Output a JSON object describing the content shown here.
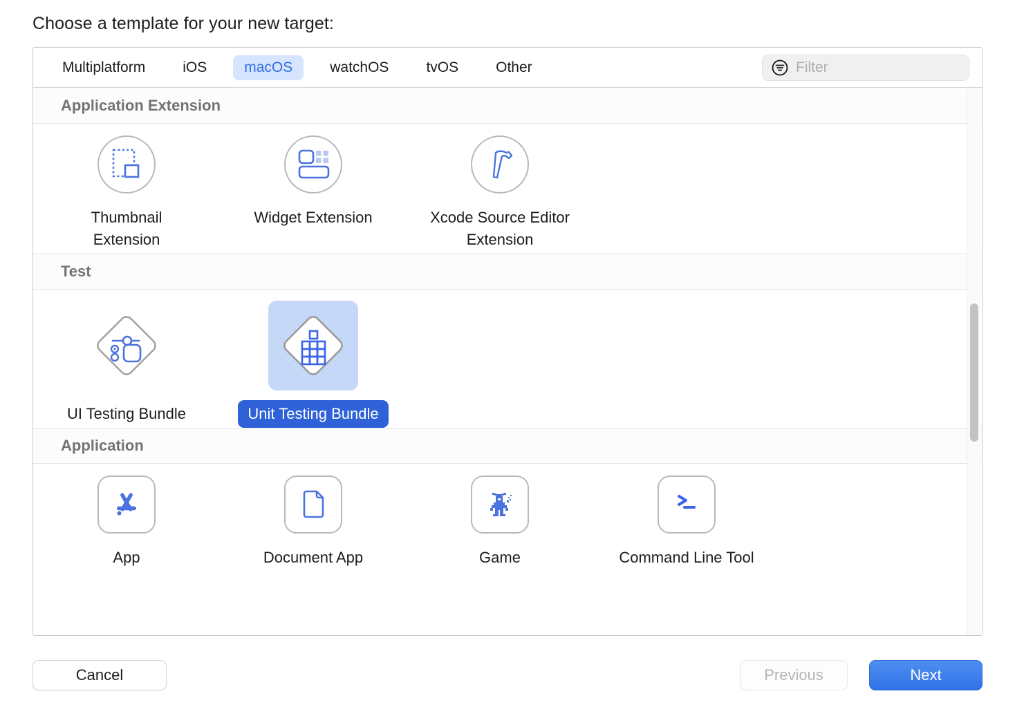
{
  "prompt": "Choose a template for your new target:",
  "tabs": [
    {
      "label": "Multiplatform",
      "active": false
    },
    {
      "label": "iOS",
      "active": false
    },
    {
      "label": "macOS",
      "active": true
    },
    {
      "label": "watchOS",
      "active": false
    },
    {
      "label": "tvOS",
      "active": false
    },
    {
      "label": "Other",
      "active": false
    }
  ],
  "filter": {
    "placeholder": "Filter",
    "icon": "filter-icon",
    "value": ""
  },
  "sections": [
    {
      "header": "Application Extension",
      "items": [
        {
          "label": "Thumbnail Extension",
          "icon": "thumbnail-extension-icon",
          "selected": false
        },
        {
          "label": "Widget Extension",
          "icon": "widget-extension-icon",
          "selected": false
        },
        {
          "label": "Xcode Source Editor Extension",
          "icon": "hammer-icon",
          "selected": false
        }
      ]
    },
    {
      "header": "Test",
      "items": [
        {
          "label": "UI Testing Bundle",
          "icon": "ui-testing-bundle-icon",
          "selected": false
        },
        {
          "label": "Unit Testing Bundle",
          "icon": "unit-testing-bundle-icon",
          "selected": true
        }
      ]
    },
    {
      "header": "Application",
      "items": [
        {
          "label": "App",
          "icon": "app-store-icon",
          "selected": false
        },
        {
          "label": "Document App",
          "icon": "document-icon",
          "selected": false
        },
        {
          "label": "Game",
          "icon": "game-robot-icon",
          "selected": false
        },
        {
          "label": "Command Line Tool",
          "icon": "terminal-prompt-icon",
          "selected": false
        }
      ]
    }
  ],
  "buttons": {
    "cancel": "Cancel",
    "previous": "Previous",
    "next": "Next"
  },
  "colors": {
    "accent": "#2f72e8",
    "selection_bg": "#c5d8f7",
    "selection_label_bg": "#2f62d8",
    "tab_active_bg": "#d6e4fd",
    "tab_active_text": "#2f6fe4",
    "icon_blue": "#4a72e0"
  },
  "scrollbar": {
    "visible": true
  }
}
